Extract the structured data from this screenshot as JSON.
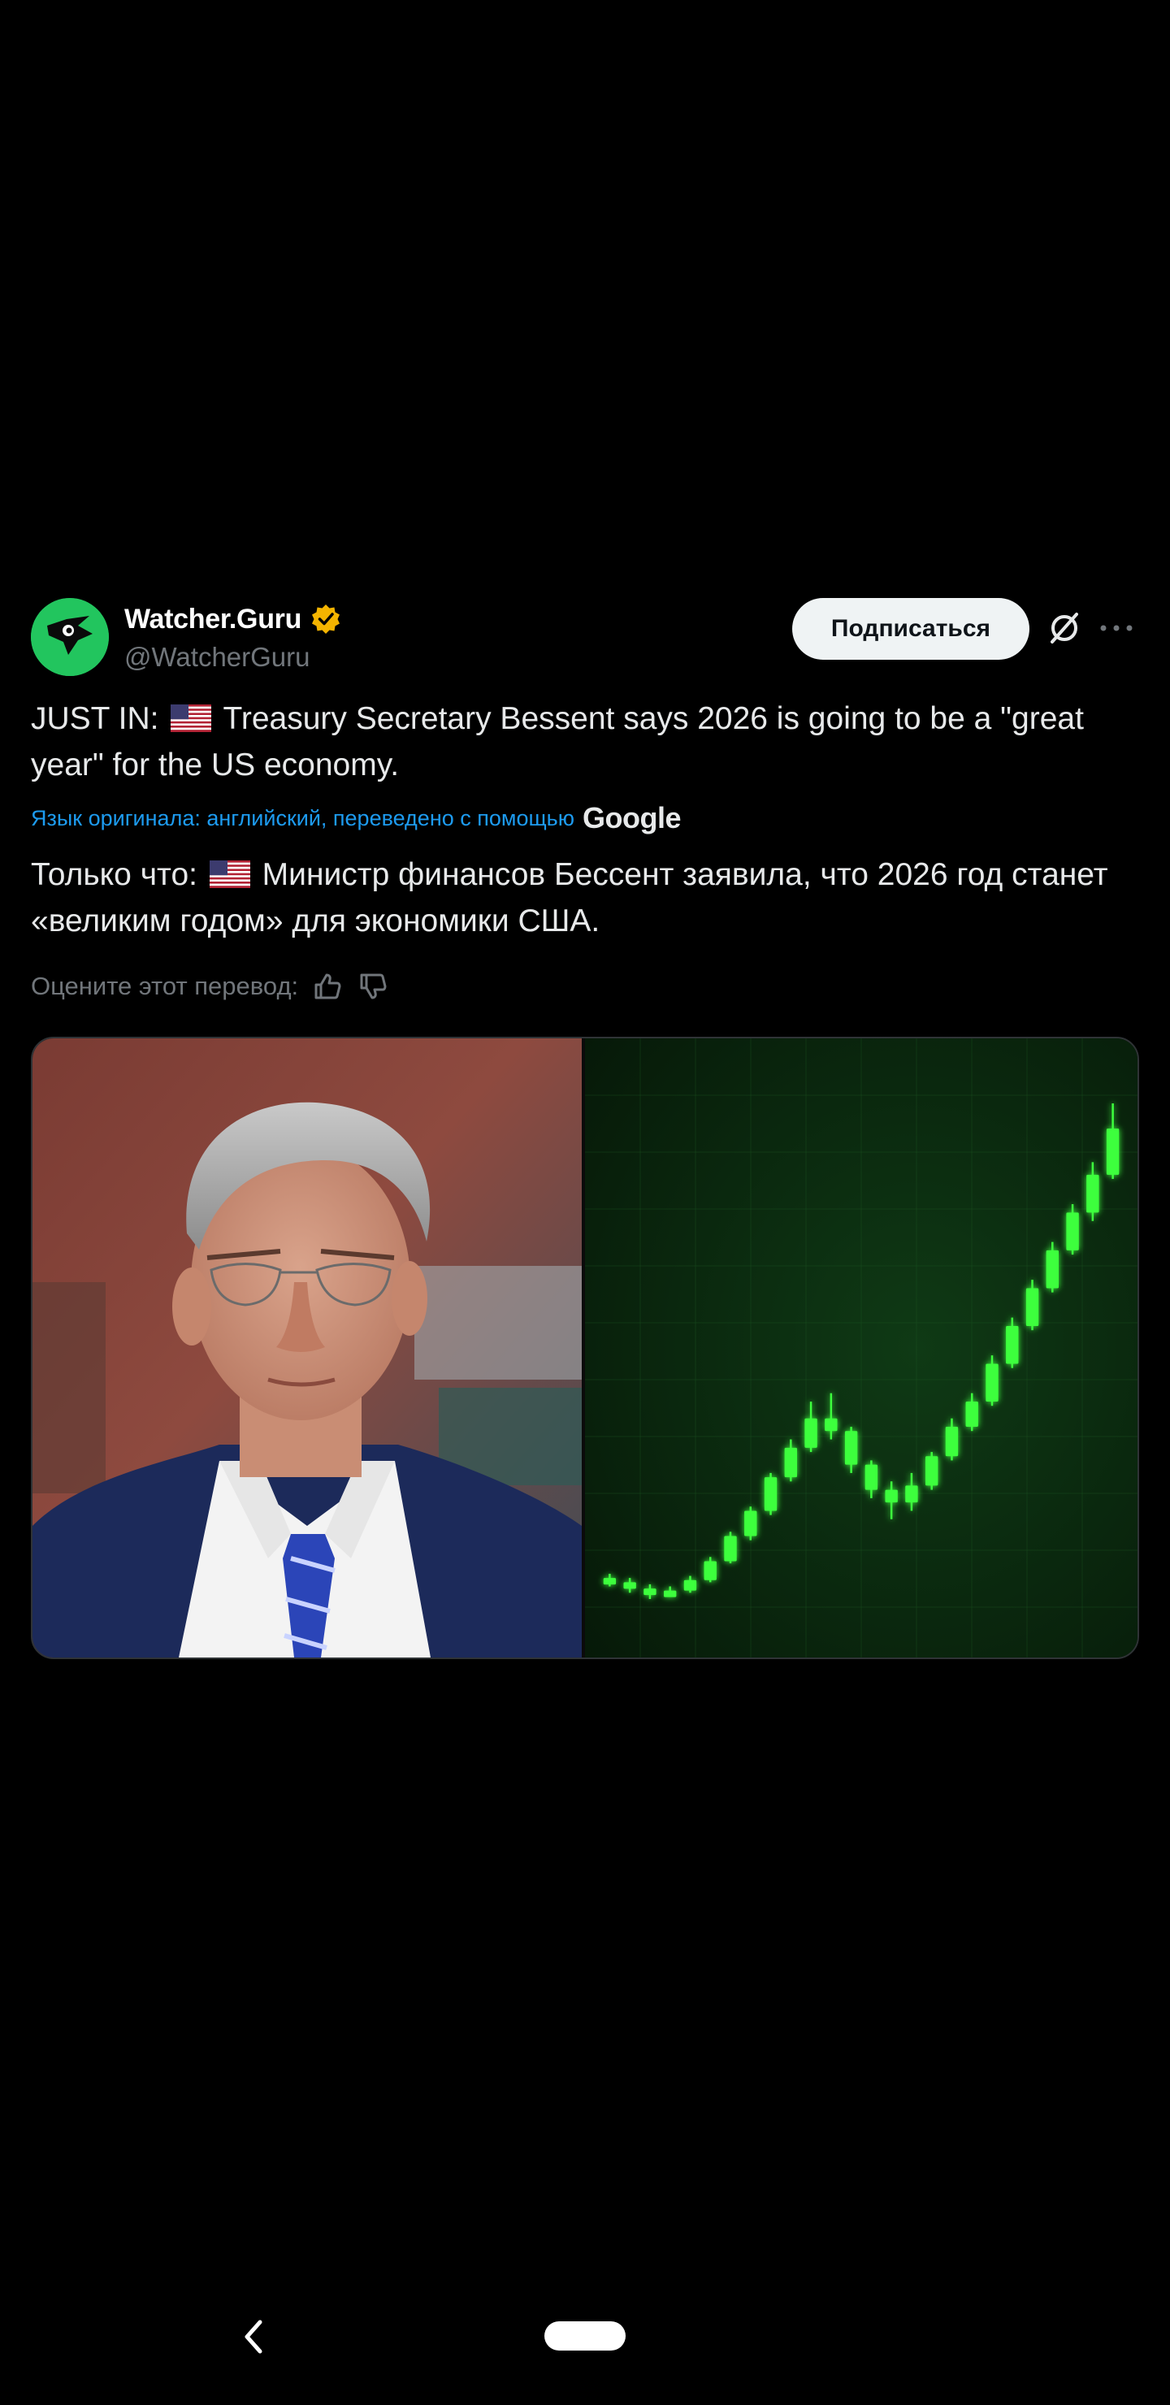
{
  "post": {
    "author_name": "Watcher.Guru",
    "author_handle": "@WatcherGuru",
    "verified": true,
    "subscribe_label": "Подписаться",
    "text_en_prefix": "JUST IN:",
    "text_en_body": "Treasury Secretary Bessent says 2026 is going to be a \"great year\" for the US economy.",
    "translation_note": "Язык оригинала: английский, переведено с помощью",
    "translation_provider": "Google",
    "text_ru_prefix": "Только что:",
    "text_ru_body": "Министр финансов Бессент заявила, что 2026 год станет «великим годом» для экономики США.",
    "rate_label": "Оцените этот перевод:",
    "flag": "us-flag-icon"
  },
  "icons": {
    "avatar": "watcher-guru-logo",
    "verified": "verified-badge-icon",
    "grok": "grok-icon",
    "more": "more-dots-icon",
    "like": "thumbs-up-icon",
    "dislike": "thumbs-down-icon",
    "back": "back-chevron-icon",
    "home": "home-pill"
  },
  "colors": {
    "background": "#000000",
    "text": "#e7e9ea",
    "secondary": "#71767b",
    "link": "#1d9bf0",
    "verified": "#f4b400",
    "avatar_bg": "#22c55e",
    "candle": "#3cff3c",
    "chart_bg": "#0b2a0f"
  },
  "media": {
    "left": "portrait-photo",
    "right": "rising-candlestick-chart",
    "candles": [
      {
        "o": 0.5,
        "c": 0.4,
        "h": 0.6,
        "l": 0.3
      },
      {
        "o": 0.4,
        "c": 0.25,
        "h": 0.5,
        "l": 0.15
      },
      {
        "o": 0.25,
        "c": 0.1,
        "h": 0.35,
        "l": 0.0
      },
      {
        "o": 0.1,
        "c": 0.2,
        "h": 0.3,
        "l": 0.05
      },
      {
        "o": 0.2,
        "c": 0.45,
        "h": 0.55,
        "l": 0.15
      },
      {
        "o": 0.45,
        "c": 0.9,
        "h": 1.0,
        "l": 0.4
      },
      {
        "o": 0.9,
        "c": 1.5,
        "h": 1.6,
        "l": 0.85
      },
      {
        "o": 1.5,
        "c": 2.1,
        "h": 2.2,
        "l": 1.4
      },
      {
        "o": 2.1,
        "c": 2.9,
        "h": 3.0,
        "l": 2.0
      },
      {
        "o": 2.9,
        "c": 3.6,
        "h": 3.8,
        "l": 2.8
      },
      {
        "o": 3.6,
        "c": 4.3,
        "h": 4.7,
        "l": 3.5
      },
      {
        "o": 4.3,
        "c": 4.0,
        "h": 4.9,
        "l": 3.8
      },
      {
        "o": 4.0,
        "c": 3.2,
        "h": 4.1,
        "l": 3.0
      },
      {
        "o": 3.2,
        "c": 2.6,
        "h": 3.3,
        "l": 2.4
      },
      {
        "o": 2.6,
        "c": 2.3,
        "h": 2.8,
        "l": 1.9
      },
      {
        "o": 2.3,
        "c": 2.7,
        "h": 3.0,
        "l": 2.1
      },
      {
        "o": 2.7,
        "c": 3.4,
        "h": 3.5,
        "l": 2.6
      },
      {
        "o": 3.4,
        "c": 4.1,
        "h": 4.3,
        "l": 3.3
      },
      {
        "o": 4.1,
        "c": 4.7,
        "h": 4.9,
        "l": 4.0
      },
      {
        "o": 4.7,
        "c": 5.6,
        "h": 5.8,
        "l": 4.6
      },
      {
        "o": 5.6,
        "c": 6.5,
        "h": 6.7,
        "l": 5.5
      },
      {
        "o": 6.5,
        "c": 7.4,
        "h": 7.6,
        "l": 6.4
      },
      {
        "o": 7.4,
        "c": 8.3,
        "h": 8.5,
        "l": 7.3
      },
      {
        "o": 8.3,
        "c": 9.2,
        "h": 9.4,
        "l": 8.2
      },
      {
        "o": 9.2,
        "c": 10.1,
        "h": 10.4,
        "l": 9.0
      },
      {
        "o": 10.1,
        "c": 11.2,
        "h": 11.8,
        "l": 10.0
      }
    ]
  }
}
